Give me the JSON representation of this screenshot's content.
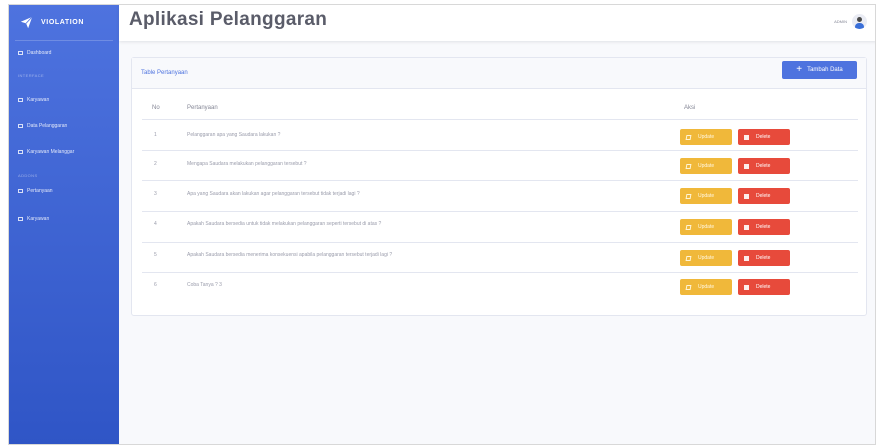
{
  "brand": {
    "name": "VIOLATION",
    "icon": "paper-plane-icon"
  },
  "sidebar": {
    "items": [
      {
        "type": "item",
        "label": "Dashboard",
        "icon": "dashboard-icon"
      },
      {
        "type": "heading",
        "label": "INTERFACE"
      },
      {
        "type": "item",
        "label": "Karyawan",
        "icon": "table-icon"
      },
      {
        "type": "item",
        "label": "Data Pelanggaran",
        "icon": "table-icon"
      },
      {
        "type": "item",
        "label": "Karyawan Melanggar",
        "icon": "table-icon"
      },
      {
        "type": "heading",
        "label": "ADDONS"
      },
      {
        "type": "item",
        "label": "Pertanyaan",
        "icon": "table-icon"
      },
      {
        "type": "item",
        "label": "Karyawan",
        "icon": "table-icon"
      }
    ]
  },
  "topbar": {
    "title": "Aplikasi Pelanggaran",
    "user": "ADMIN"
  },
  "card": {
    "title": "Table Pertanyaan",
    "add_label": "Tambah Data"
  },
  "table": {
    "headers": [
      "No",
      "Pertanyaan",
      "Aksi"
    ],
    "rows": [
      {
        "no": "1",
        "q": "Pelanggaran apa yang Saudara lakukan ?"
      },
      {
        "no": "2",
        "q": "Mengapa Saudara melakukan pelanggaran tersebut ?"
      },
      {
        "no": "3",
        "q": "Apa yang Saudara akan lakukan agar pelanggaran tersebut tidak terjadi lagi ?"
      },
      {
        "no": "4",
        "q": "Apakah Saudara bersedia untuk tidak melakukan pelanggaran seperti tersebut di atas ?"
      },
      {
        "no": "5",
        "q": "Apakah Saudara bersedia menerima konsekuensi apabila pelanggaran tersebut terjadi lagi ?"
      },
      {
        "no": "6",
        "q": "Coba Tanya ? 3"
      }
    ],
    "update_label": "Update",
    "delete_label": "Delete"
  },
  "colors": {
    "primary": "#4e73df",
    "warning": "#f6c23e",
    "danger": "#e74a3b"
  }
}
